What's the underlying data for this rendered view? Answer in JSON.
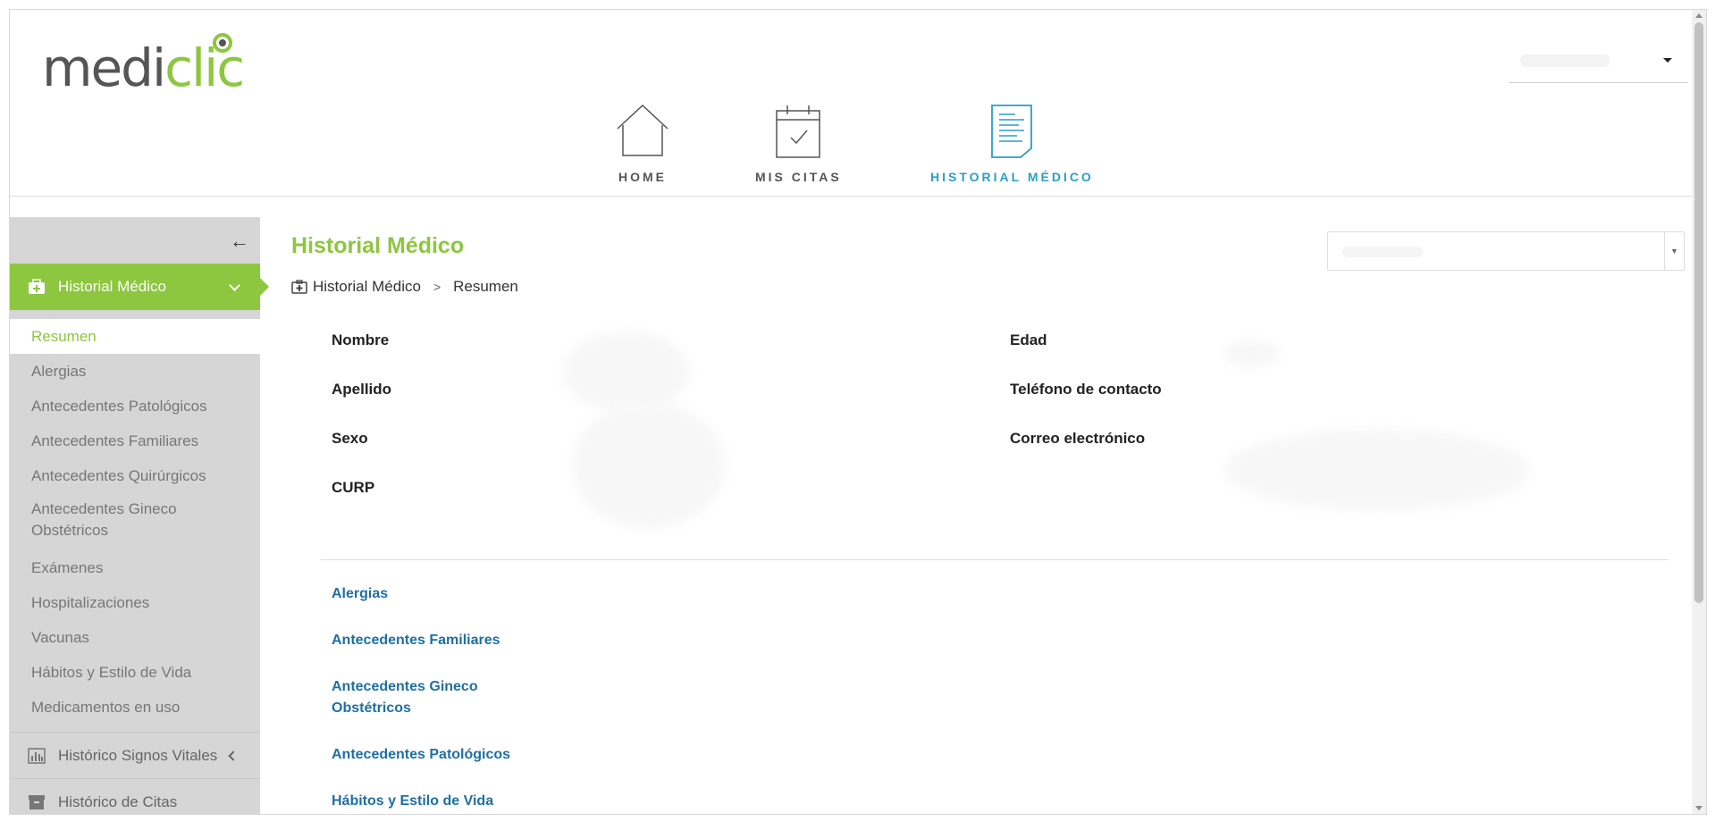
{
  "header": {
    "logo": {
      "part1": "medi",
      "part2": "clic"
    },
    "nav": [
      {
        "label": "HOME",
        "icon": "home-icon"
      },
      {
        "label": "MIS CITAS",
        "icon": "calendar-check-icon"
      },
      {
        "label": "HISTORIAL MÉDICO",
        "icon": "document-icon",
        "active": true
      }
    ]
  },
  "sidebar": {
    "collapse_icon": "arrow-left-icon",
    "active_section": {
      "label": "Historial Médico",
      "icon": "medical-case-icon"
    },
    "items": [
      {
        "label": "Resumen",
        "active": true
      },
      {
        "label": "Alergias"
      },
      {
        "label": "Antecedentes Patológicos"
      },
      {
        "label": "Antecedentes Familiares"
      },
      {
        "label": "Antecedentes Quirúrgicos"
      },
      {
        "label": "Antecedentes Gineco Obstétricos"
      },
      {
        "label": "Exámenes"
      },
      {
        "label": "Hospitalizaciones"
      },
      {
        "label": "Vacunas"
      },
      {
        "label": "Hábitos y Estilo de Vida"
      },
      {
        "label": "Medicamentos en uso"
      }
    ],
    "sections": [
      {
        "label": "Histórico Signos Vitales",
        "icon": "bar-chart-icon"
      },
      {
        "label": "Histórico de Citas",
        "icon": "archive-icon"
      }
    ]
  },
  "main": {
    "title": "Historial Médico",
    "breadcrumb": {
      "root": "Historial Médico",
      "separator": ">",
      "current": "Resumen"
    },
    "patient_info": {
      "left": [
        "Nombre",
        "Apellido",
        "Sexo",
        "CURP"
      ],
      "right": [
        "Edad",
        "Teléfono de contacto",
        "Correo electrónico"
      ]
    },
    "links": [
      "Alergias",
      "Antecedentes Familiares",
      "Antecedentes Gineco Obstétricos",
      "Antecedentes Patológicos",
      "Hábitos y Estilo de Vida"
    ]
  },
  "colors": {
    "brand_green": "#8dc63f",
    "brand_blue": "#2a9ec7",
    "link_blue": "#1f6fa2",
    "sidebar_bg": "#d6d6d6"
  }
}
